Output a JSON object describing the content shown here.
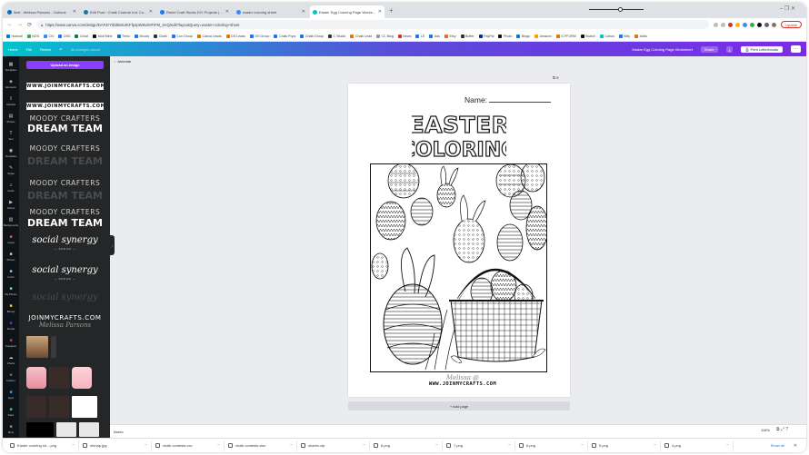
{
  "browser": {
    "tabs": [
      {
        "label": "Mail - Melissa Parsons - Outlook",
        "color": "#0f6cbd"
      },
      {
        "label": "Edit Post ‹ Chalk Couture Ind. Co...",
        "color": "#21759b"
      },
      {
        "label": "Rebel Craft Studio DIY Projects | ...",
        "color": "#1877f2"
      },
      {
        "label": "easter coloring sheet",
        "color": "#4285f4"
      },
      {
        "label": "Easter Egg Coloring Page Workshe...",
        "color": "#00c4cc",
        "active": true
      }
    ],
    "new_tab": "+",
    "window_controls": "–  ❐  ✕",
    "url": "https://www.canva.com/design/DAFZrYiD3bMUrKFfp4pW6vdHFiFM_4AQ/edit?layoutQuery=easter+coloring+sheet",
    "update_label": "Update",
    "bookmarks": [
      {
        "label": "Hotmail",
        "color": "#0078d4"
      },
      {
        "label": "NOS",
        "color": "#34a853"
      },
      {
        "label": "CIV",
        "color": "#4285f4"
      },
      {
        "label": "DSS",
        "color": "#1877f2"
      },
      {
        "label": "Cricut",
        "color": "#0c7e3e"
      },
      {
        "label": "Mod Mine",
        "color": "#111111"
      },
      {
        "label": "Trello",
        "color": "#0079bf"
      },
      {
        "label": "Moody",
        "color": "#1877f2"
      },
      {
        "label": "Chalk",
        "color": "#333333"
      },
      {
        "label": "Con Group",
        "color": "#1877f2"
      },
      {
        "label": "Canva Leads",
        "color": "#e37400"
      },
      {
        "label": "DS Leads",
        "color": "#e37400"
      },
      {
        "label": "DS Group",
        "color": "#1877f2"
      },
      {
        "label": "Chalk Pops",
        "color": "#1877f2"
      },
      {
        "label": "Chalk Group",
        "color": "#1877f2"
      },
      {
        "label": "C Studio",
        "color": "#333333"
      },
      {
        "label": "Chalk Lead",
        "color": "#e37400"
      },
      {
        "label": "CC Blog",
        "color": "#999999"
      },
      {
        "label": "News",
        "color": "#d93025"
      },
      {
        "label": "LE",
        "color": "#1877f2"
      },
      {
        "label": "Ads",
        "color": "#1a73e8"
      },
      {
        "label": "Etsy",
        "color": "#f1641e"
      },
      {
        "label": "Buffer",
        "color": "#333333"
      },
      {
        "label": "PayPal",
        "color": "#003087"
      },
      {
        "label": "Photo",
        "color": "#111111"
      },
      {
        "label": "Bingo",
        "color": "#0078d4"
      },
      {
        "label": "Amazon",
        "color": "#ff9900"
      },
      {
        "label": "ICFFORM",
        "color": "#e37400"
      },
      {
        "label": "Switch",
        "color": "#111111"
      },
      {
        "label": "Canva",
        "color": "#00c4cc"
      },
      {
        "label": "Kitty",
        "color": "#1877f2"
      },
      {
        "label": "Adds",
        "color": "#e37400"
      }
    ]
  },
  "canva": {
    "header": {
      "home": "Home",
      "file": "File",
      "resize": "Resize",
      "undo": "↶",
      "saved": "All changes saved",
      "doc_title": "Easter Egg Coloring Page Worksheet",
      "share": "Share",
      "download": "⤓",
      "print": "Print Letterheads",
      "more": "···"
    },
    "rail": [
      {
        "icon": "▦",
        "label": "Templates"
      },
      {
        "icon": "◈",
        "label": "Elements"
      },
      {
        "icon": "⇪",
        "label": "Uploads"
      },
      {
        "icon": "▤",
        "label": "Photos"
      },
      {
        "icon": "T",
        "label": "Text"
      },
      {
        "icon": "◉",
        "label": "Templates"
      },
      {
        "icon": "✎",
        "label": "Styles"
      },
      {
        "icon": "♫",
        "label": "Audio"
      },
      {
        "icon": "▶",
        "label": "Videos"
      },
      {
        "icon": "▥",
        "label": "Backgrounds"
      },
      {
        "icon": "■",
        "label": "Logos",
        "color": "#ff4d6d"
      },
      {
        "icon": "■",
        "label": "Photos",
        "color": "#cfcfcf"
      },
      {
        "icon": "■",
        "label": "Fonts",
        "color": "#9ec9ff"
      },
      {
        "icon": "■",
        "label": "My Photos",
        "color": "#79e2c0"
      },
      {
        "icon": "■",
        "label": "Bitmoji",
        "color": "#ffd700"
      },
      {
        "icon": "■",
        "label": "Pexels",
        "color": "#7d2ae8"
      },
      {
        "icon": "■",
        "label": "Instagram",
        "color": "#e1306c"
      },
      {
        "icon": "☁",
        "label": "Charts"
      },
      {
        "icon": "■",
        "label": "Folders",
        "color": "#6c6c6c"
      },
      {
        "icon": "■",
        "label": "Apps",
        "color": "#3aa0ff"
      },
      {
        "icon": "■",
        "label": "Draw",
        "color": "#5bd15b"
      },
      {
        "icon": "■",
        "label": "More",
        "color": "#8b8b8b"
      }
    ],
    "panel": {
      "upload_label": "Upload an image",
      "brand_items": [
        "WWW.JOINMYCRAFTS.COM",
        "WWW.JOINMYCRAFTS.COM",
        "MOODY CRAFTERS",
        "DREAM TEAM",
        "MOODY CRAFTERS",
        "DREAM TEAM",
        "MOODY CRAFTERS",
        "DREAM TEAM",
        "MOODY CRAFTERS",
        "DREAM TEAM",
        "social synergy",
        "— SQUAD —",
        "social synergy",
        "— SQUAD —",
        "social synergy",
        "JOINMYCRAFTS.COM",
        "Melissa Parsons"
      ],
      "collapse_icon": "‹"
    },
    "canvas": {
      "animate": "Animate",
      "page_tools": "⧉  ⊕",
      "name_label": "Name:",
      "title_line1": "EASTER",
      "title_line2": "COLORING",
      "signature_script": "Melissa @",
      "signature_url": "WWW.JOINMYCRAFTS.COM",
      "add_page": "+ Add page"
    },
    "statusbar": {
      "notes": "Notes",
      "zoom": "118%",
      "icons": "⧉  ⤢  ?"
    }
  },
  "downloads": {
    "items": [
      "Easter coloring sh....png",
      "mknap.jpg",
      "chalk contests.csv",
      "chalk contests.xlsx",
      "shares.zip",
      "8.png",
      "7.png",
      "6.png",
      "5.png",
      "4.png"
    ],
    "show_all": "Show all",
    "close": "✕"
  }
}
